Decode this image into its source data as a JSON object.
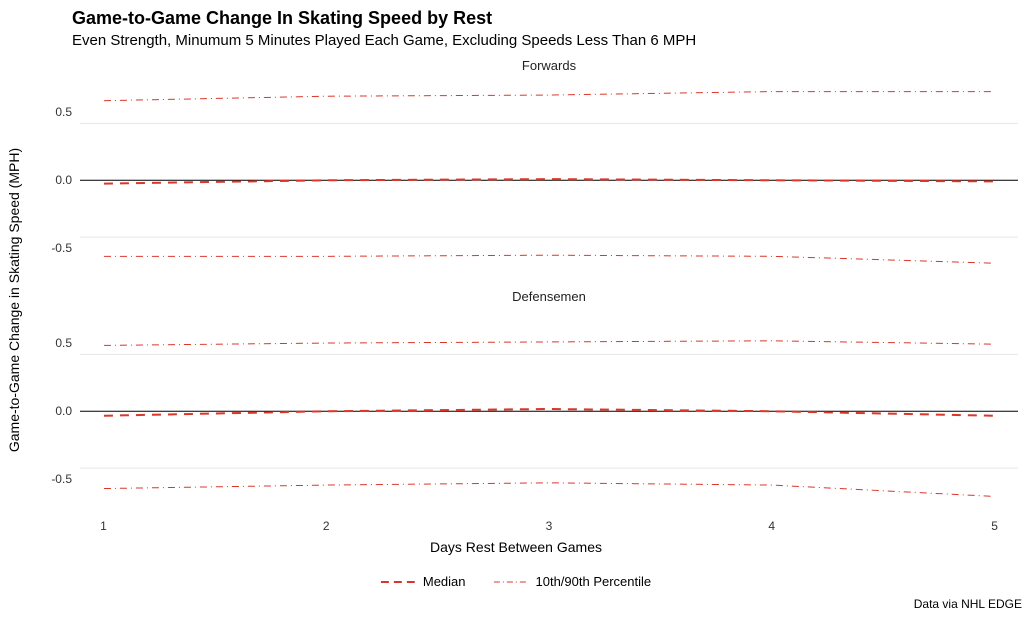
{
  "title": "Game-to-Game Change In Skating Speed by Rest",
  "subtitle": "Even Strength, Minumum 5 Minutes Played Each Game, Excluding Speeds Less Than 6 MPH",
  "ylabel": "Game-to-Game Change in Skating Speed (MPH)",
  "xlabel": "Days Rest Between Games",
  "credit": "Data via NHL EDGE",
  "legend": {
    "median": "Median",
    "pct": "10th/90th Percentile"
  },
  "facets": [
    {
      "label": "Forwards"
    },
    {
      "label": "Defensemen"
    }
  ],
  "yticks": [
    "-0.5",
    "0.0",
    "0.5"
  ],
  "xticks": [
    "1",
    "2",
    "3",
    "4",
    "5"
  ],
  "chart_data": [
    {
      "type": "line",
      "facet": "Forwards",
      "x": [
        1,
        2,
        3,
        4,
        5
      ],
      "ylim": [
        -0.9,
        0.9
      ],
      "xlabel": "Days Rest Between Games",
      "ylabel": "Game-to-Game Change in Skating Speed (MPH)",
      "series": [
        {
          "name": "Median",
          "values": [
            -0.03,
            0.0,
            0.01,
            0.0,
            -0.01
          ]
        },
        {
          "name": "90th Percentile",
          "values": [
            0.7,
            0.74,
            0.75,
            0.78,
            0.78
          ]
        },
        {
          "name": "10th Percentile",
          "values": [
            -0.67,
            -0.67,
            -0.66,
            -0.67,
            -0.73
          ]
        }
      ]
    },
    {
      "type": "line",
      "facet": "Defensemen",
      "x": [
        1,
        2,
        3,
        4,
        5
      ],
      "ylim": [
        -0.9,
        0.9
      ],
      "xlabel": "Days Rest Between Games",
      "ylabel": "Game-to-Game Change in Skating Speed (MPH)",
      "series": [
        {
          "name": "Median",
          "values": [
            -0.04,
            0.0,
            0.02,
            0.0,
            -0.04
          ]
        },
        {
          "name": "90th Percentile",
          "values": [
            0.58,
            0.6,
            0.61,
            0.62,
            0.59
          ]
        },
        {
          "name": "10th Percentile",
          "values": [
            -0.68,
            -0.65,
            -0.63,
            -0.65,
            -0.75
          ]
        }
      ]
    }
  ],
  "colors": {
    "median": "#d8372b",
    "pct": "#d8372b",
    "grid": "#e6e6e6",
    "zero": "#000000"
  }
}
